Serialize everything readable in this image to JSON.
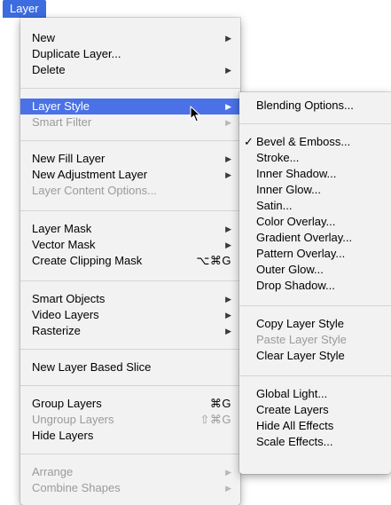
{
  "menubar": {
    "title": "Layer"
  },
  "main_menu": {
    "items": [
      {
        "label": "New",
        "arrow": "▶"
      },
      {
        "label": "Duplicate Layer..."
      },
      {
        "label": "Delete",
        "arrow": "▶"
      },
      {
        "label": "Layer Style",
        "arrow": "▶"
      },
      {
        "label": "Smart Filter",
        "arrow": "▶"
      },
      {
        "label": "New Fill Layer",
        "arrow": "▶"
      },
      {
        "label": "New Adjustment Layer",
        "arrow": "▶"
      },
      {
        "label": "Layer Content Options..."
      },
      {
        "label": "Layer Mask",
        "arrow": "▶"
      },
      {
        "label": "Vector Mask",
        "arrow": "▶"
      },
      {
        "label": "Create Clipping Mask",
        "shortcut": "⌥⌘G"
      },
      {
        "label": "Smart Objects",
        "arrow": "▶"
      },
      {
        "label": "Video Layers",
        "arrow": "▶"
      },
      {
        "label": "Rasterize",
        "arrow": "▶"
      },
      {
        "label": "New Layer Based Slice"
      },
      {
        "label": "Group Layers",
        "shortcut": "⌘G"
      },
      {
        "label": "Ungroup Layers",
        "shortcut": "⇧⌘G"
      },
      {
        "label": "Hide Layers"
      },
      {
        "label": "Arrange",
        "arrow": "▶"
      },
      {
        "label": "Combine Shapes",
        "arrow": "▶"
      }
    ]
  },
  "submenu": {
    "items": [
      {
        "label": "Blending Options..."
      },
      {
        "label": "Bevel & Emboss...",
        "check": "✓"
      },
      {
        "label": "Stroke..."
      },
      {
        "label": "Inner Shadow..."
      },
      {
        "label": "Inner Glow..."
      },
      {
        "label": "Satin..."
      },
      {
        "label": "Color Overlay..."
      },
      {
        "label": "Gradient Overlay..."
      },
      {
        "label": "Pattern Overlay..."
      },
      {
        "label": "Outer Glow..."
      },
      {
        "label": "Drop Shadow..."
      },
      {
        "label": "Copy Layer Style"
      },
      {
        "label": "Paste Layer Style"
      },
      {
        "label": "Clear Layer Style"
      },
      {
        "label": "Global Light..."
      },
      {
        "label": "Create Layers"
      },
      {
        "label": "Hide All Effects"
      },
      {
        "label": "Scale Effects..."
      }
    ]
  },
  "colors": {
    "highlight": "#4a72e6",
    "menubar_highlight": "#3d6be0",
    "disabled_text": "#9a9a9a",
    "menu_background": "#f2f2f2"
  }
}
